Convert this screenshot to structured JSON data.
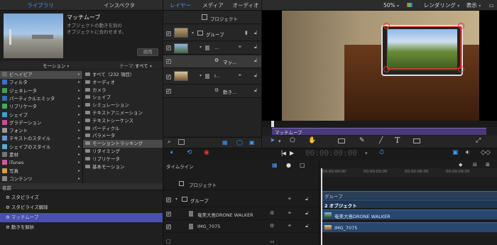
{
  "tabs": {
    "library": "ライブラリ",
    "inspector": "インスペクタ",
    "layers": "レイヤー",
    "media": "メディア",
    "audio": "オーディオ"
  },
  "viewer_controls": {
    "zoom": "50%",
    "render": "レンダリング",
    "view": "表示"
  },
  "preview": {
    "title": "マッチムーブ",
    "desc1": "オブジェクトの動きを別の",
    "desc2": "オブジェクトに合わせます。",
    "apply": "適用"
  },
  "filter": {
    "category": "モーション",
    "search_label": "テーマ:",
    "search_value": "すべて"
  },
  "categories": [
    {
      "label": "ビヘイビア",
      "color": "#6a6a6a"
    },
    {
      "label": "フィルタ",
      "color": "#3b6fd8"
    },
    {
      "label": "ジェネレータ",
      "color": "#3fa34d"
    },
    {
      "label": "パーティクルエミッタ",
      "color": "#2d6fb8"
    },
    {
      "label": "リプリケータ",
      "color": "#3bb05a"
    },
    {
      "label": "シェイプ",
      "color": "#3aa0d8"
    },
    {
      "label": "グラデーション",
      "color": "#d04aa0"
    },
    {
      "label": "フォント",
      "color": "#9a9a9a"
    },
    {
      "label": "テキストのスタイル",
      "color": "#5e9ad8"
    },
    {
      "label": "シェイプのスタイル",
      "color": "#4fb0d8"
    },
    {
      "label": "素材",
      "color": "#777777"
    },
    {
      "label": "iTunes",
      "color": "#d05a9a"
    },
    {
      "label": "写真",
      "color": "#d8a03a"
    },
    {
      "label": "コンテンツ",
      "color": "#888888"
    }
  ],
  "subcategories": [
    "すべて（232 項目）",
    "オーディオ",
    "カメラ",
    "シェイプ",
    "シミュレーション",
    "テキストアニメーション",
    "テキストシーケンス",
    "パーティクル",
    "パラメータ",
    "モーショントラッキング",
    "リタイミング",
    "リプリケータ",
    "基本モーション"
  ],
  "items_header": "名前",
  "items": [
    "スタビライズ",
    "スタビライズ解除",
    "マッチムーブ",
    "動きを解析"
  ],
  "layers": {
    "project": "プロジェクト",
    "group": "グループ",
    "row1": "...",
    "match1": "マッ...",
    "row3": "I...",
    "motion": "動き..."
  },
  "viewer_label": "マッチムーブ",
  "timecode": "00:00:00:00",
  "timeline": {
    "label": "タイムライン",
    "project": "プロジェクト",
    "group": "グループ",
    "clip1": "奄美大島DRONE WALKER",
    "clip2": "IMG_7075",
    "ticks": [
      "00:00:00:00",
      "00:00:03:00",
      "00:00:06:00",
      "00:00:09:00"
    ],
    "bar_group": "グループ",
    "bar_objects": "2 オブジェクト",
    "bar_clip1": "奄美大島DRONE WALKER",
    "bar_clip2": "IMG_7075"
  }
}
